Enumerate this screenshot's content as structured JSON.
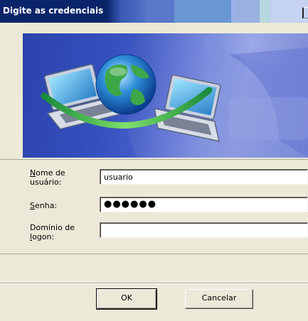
{
  "window": {
    "title": "Digite as credenciais"
  },
  "banner": {
    "icon": "network-globe-laptops-icon"
  },
  "form": {
    "username_label_mnemonic": "N",
    "username_label_rest": "ome de",
    "username_label_line2": "usuário:",
    "username_value": "usuario",
    "password_label_mnemonic": "S",
    "password_label_rest": "enha:",
    "password_value": "●●●●●●",
    "domain_label_line1": "Domínio de",
    "domain_label_mnemonic": "l",
    "domain_label_rest": "ogon:",
    "domain_value": ""
  },
  "buttons": {
    "ok_label": "OK",
    "cancel_label": "Cancelar"
  },
  "colors": {
    "title_bar": "#0a246a",
    "dialog_bg": "#ece9d8",
    "banner_blue": "#2e49b8"
  }
}
